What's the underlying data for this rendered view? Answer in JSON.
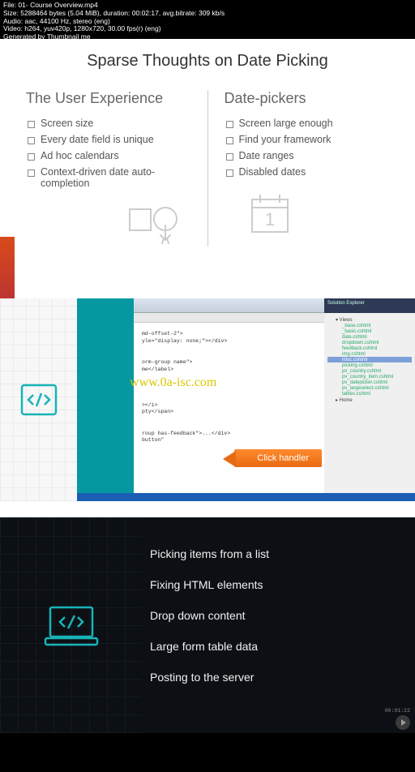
{
  "meta": {
    "line1": "File: 01- Course Overview.mp4",
    "line2": "Size: 5288464 bytes (5.04 MiB), duration: 00:02:17, avg.bitrate: 309 kb/s",
    "line3": "Audio: aac, 44100 Hz, stereo (eng)",
    "line4": "Video: h264, yuv420p, 1280x720, 30.00 fps(r) (eng)",
    "line5": "Generated by Thumbnail me"
  },
  "slide1": {
    "title": "Sparse Thoughts on Date Picking",
    "left_heading": "The User Experience",
    "left_items": [
      "Screen size",
      "Every date field is unique",
      "Ad hoc calendars",
      "Context-driven date auto-completion"
    ],
    "right_heading": "Date-pickers",
    "right_items": [
      "Screen large enough",
      "Find your framework",
      "Date ranges",
      "Disabled dates"
    ],
    "calendar_day": "1"
  },
  "slide2": {
    "watermark": "www.0a-isc.com",
    "callout": "Click handler",
    "code_lines": [
      "md-offset-2\">",
      "yle=\"display: none;\"></div>",
      "",
      "",
      "orm-group name\">",
      "me</label>",
      "",
      "",
      "",
      "",
      "></i>",
      "pty</span>",
      "",
      "",
      "roup has-feedback\">...</div>",
      "button\""
    ],
    "explorer_title": "Solution Explorer",
    "explorer_items": [
      {
        "t": "folder",
        "n": "▾ Views"
      },
      {
        "t": "file",
        "n": "_base.cshtml"
      },
      {
        "t": "file",
        "n": "_basic.cshtml"
      },
      {
        "t": "file",
        "n": "date.cshtml"
      },
      {
        "t": "file",
        "n": "dropdown.cshtml"
      },
      {
        "t": "file",
        "n": "feedback.cshtml"
      },
      {
        "t": "file",
        "n": "img.cshtml"
      },
      {
        "t": "file",
        "n": "misc.cshtml",
        "sel": true
      },
      {
        "t": "file",
        "n": "picking.cshtml"
      },
      {
        "t": "file",
        "n": "pv_country.cshtml"
      },
      {
        "t": "file",
        "n": "pv_country_item.cshtml"
      },
      {
        "t": "file",
        "n": "pv_datepicker.cshtml"
      },
      {
        "t": "file",
        "n": "pv_largeselect.cshtml"
      },
      {
        "t": "file",
        "n": "tables.cshtml"
      },
      {
        "t": "folder",
        "n": "▸ Home"
      }
    ]
  },
  "slide3": {
    "items": [
      "Picking items from a list",
      "Fixing HTML elements",
      "Drop down content",
      "Large form table data",
      "Posting to the server"
    ]
  },
  "timecode": "00:01:22"
}
